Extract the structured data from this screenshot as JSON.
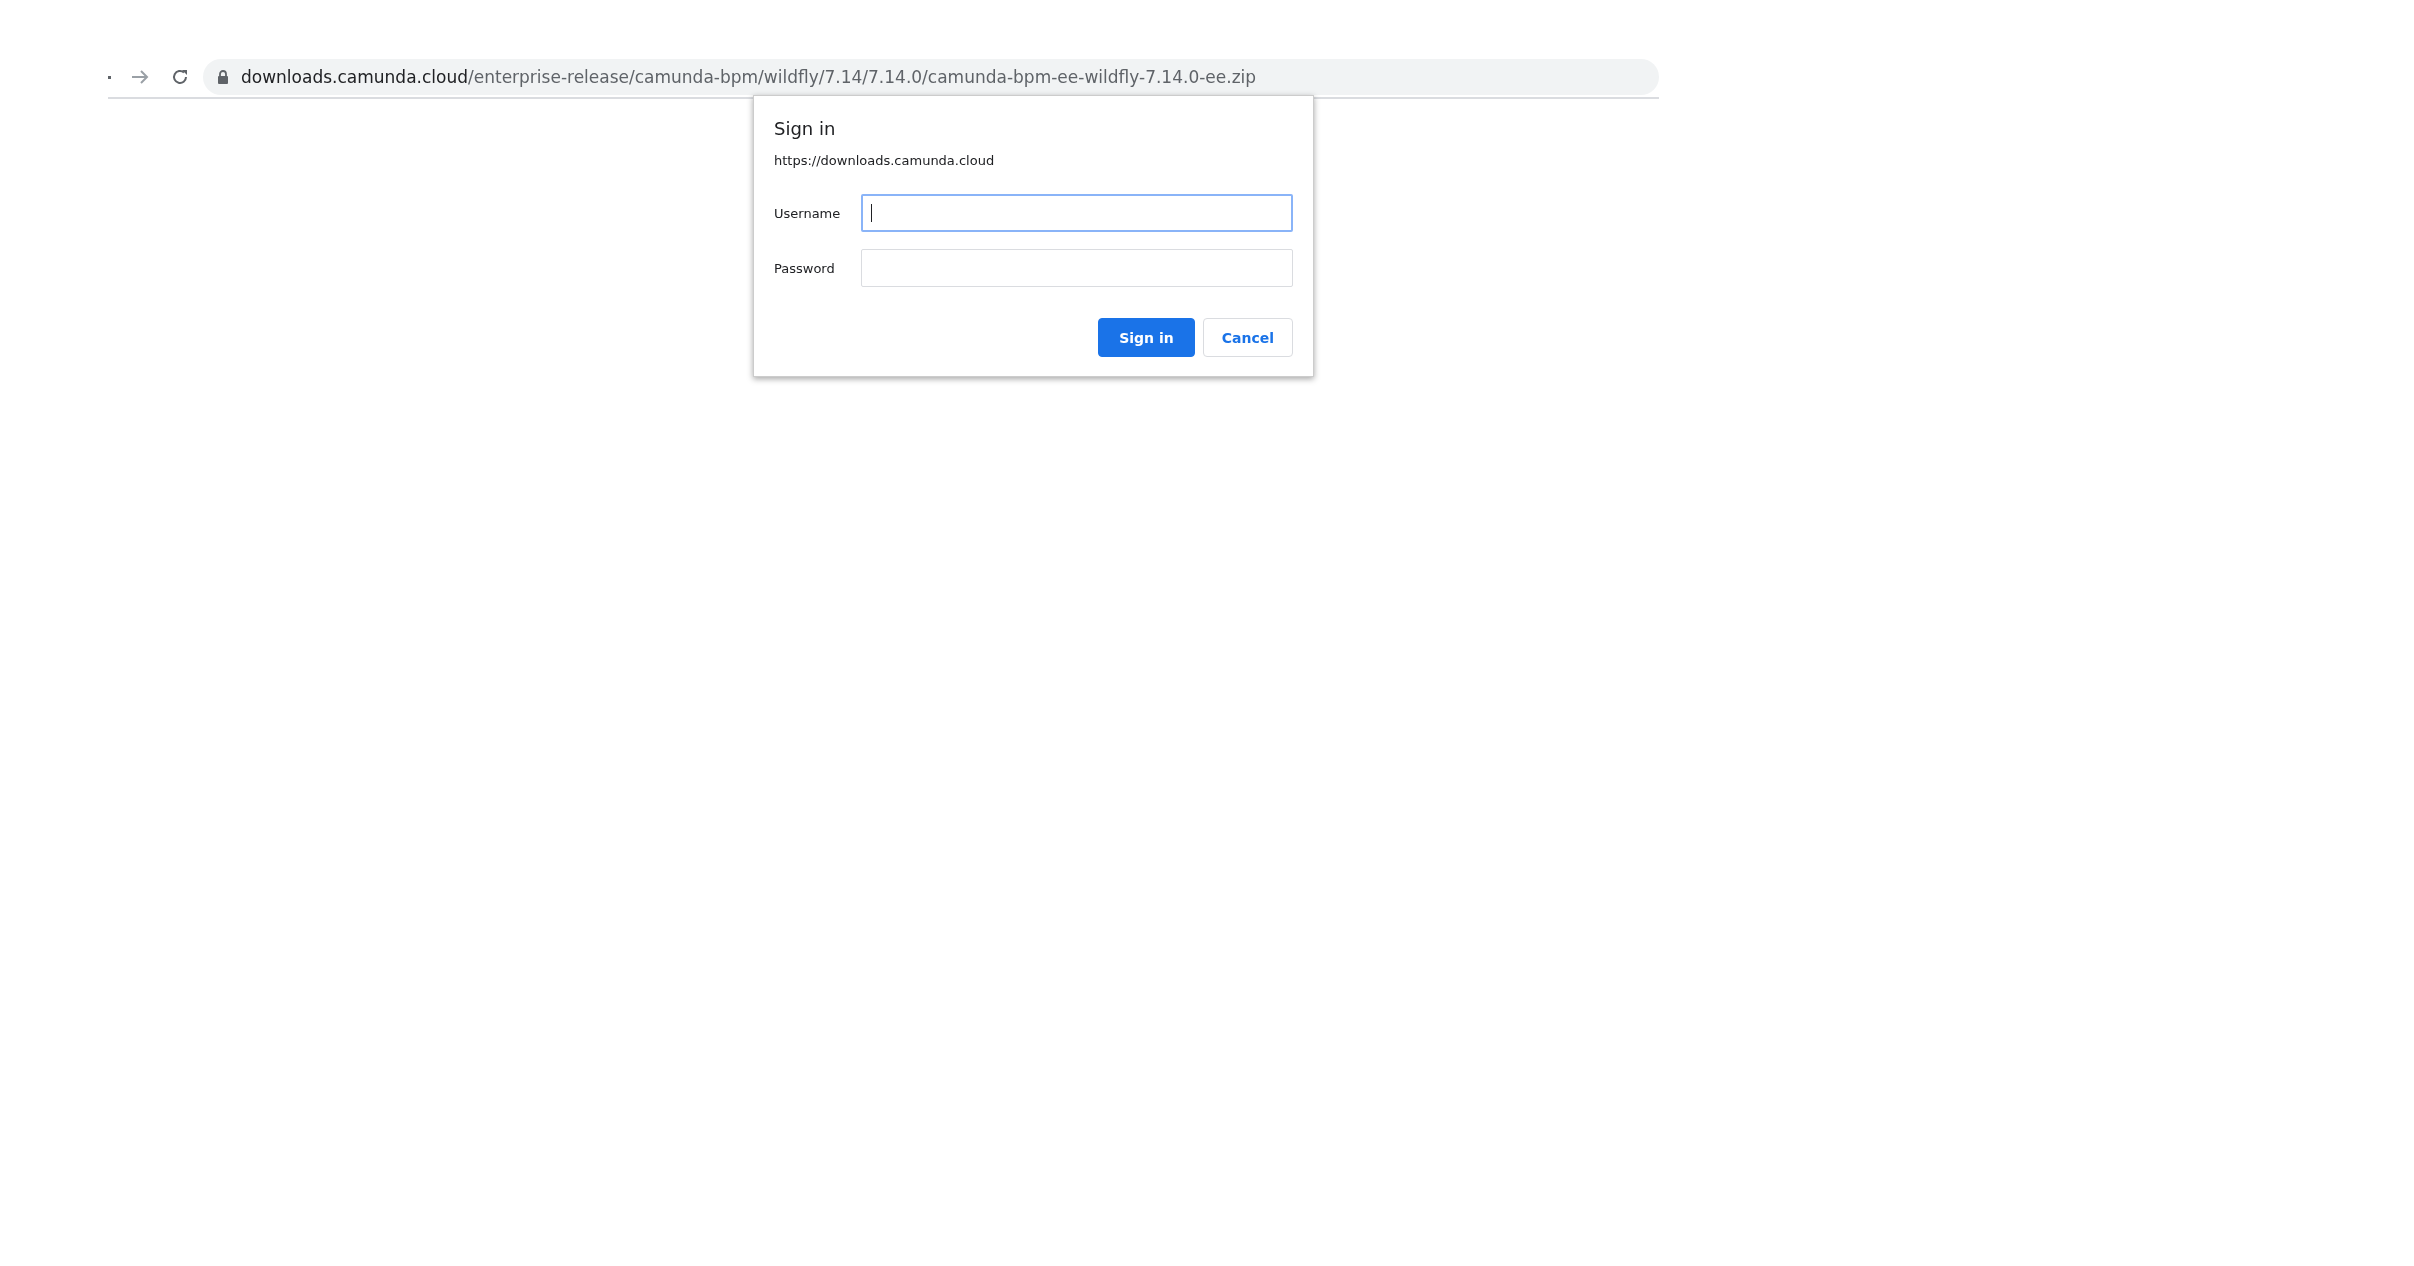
{
  "address_bar": {
    "host": "downloads.camunda.cloud",
    "path": "/enterprise-release/camunda-bpm/wildfly/7.14/7.14.0/camunda-bpm-ee-wildfly-7.14.0-ee.zip"
  },
  "dialog": {
    "title": "Sign in",
    "origin": "https://downloads.camunda.cloud",
    "fields": [
      {
        "label": "Username",
        "focused": true
      },
      {
        "label": "Password",
        "focused": false
      }
    ],
    "buttons": [
      {
        "label": "Sign in",
        "kind": "primary"
      },
      {
        "label": "Cancel",
        "kind": "secondary"
      }
    ]
  }
}
